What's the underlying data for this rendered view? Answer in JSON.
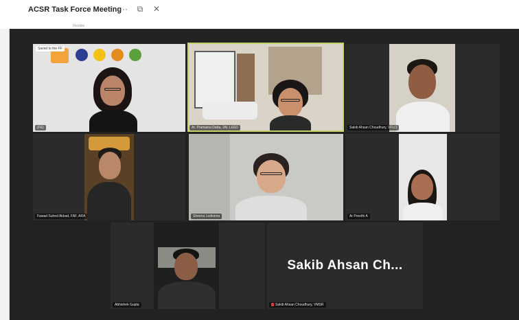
{
  "window": {
    "title": "ACSR Task Force Meeting",
    "subtitle": "Flexible",
    "icons": [
      "more-icon",
      "popout-icon",
      "close-icon"
    ],
    "more_glyph": "···",
    "popout_glyph": "⧉",
    "close_glyph": "✕"
  },
  "participants": [
    {
      "id": "p1",
      "name": "(FE)",
      "pin_label": "Saved to the FF"
    },
    {
      "id": "p2",
      "name": "Ar. Pramiana Datta, JAL LEED",
      "active": true
    },
    {
      "id": "p3",
      "name": "Sakib Ahsan Choudhury, VFLO"
    },
    {
      "id": "p4",
      "name": "Fawad Suhed Akbad, FAF, ARA"
    },
    {
      "id": "p5",
      "name": "Sheena Ledesma"
    },
    {
      "id": "p6",
      "name": "Ar Preethi A"
    },
    {
      "id": "p7",
      "name": "Abhishek Gupta"
    },
    {
      "id": "p8",
      "name": "Sakib Ahsan Choudhury, VMSR",
      "big_name": "Sakib Ahsan Ch...",
      "muted": true
    }
  ],
  "colors": {
    "stage": "#222222",
    "tile": "#2b2b2b",
    "active_outline": "#c6d36a",
    "mic_muted": "#e23b3b"
  }
}
